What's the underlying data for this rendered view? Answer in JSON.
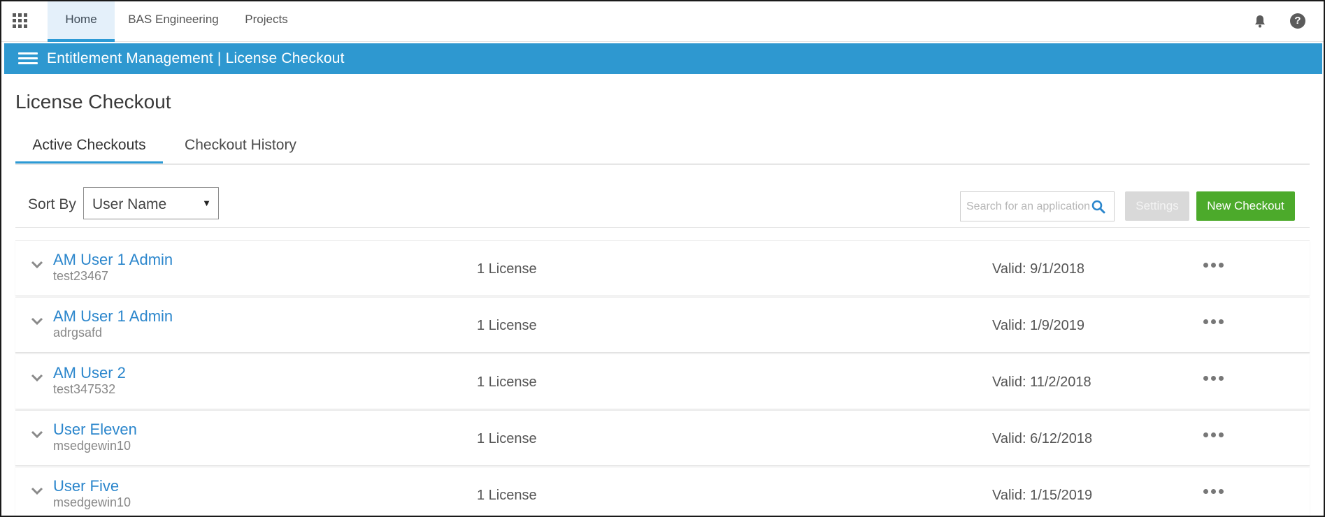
{
  "topnav": {
    "apps_icon": "apps-grid-icon",
    "tabs": [
      {
        "label": "Home",
        "active": true
      },
      {
        "label": "BAS Engineering",
        "active": false
      },
      {
        "label": "Projects",
        "active": false
      }
    ],
    "bell_icon": "bell-icon",
    "help_icon": "help-icon",
    "help_glyph": "?"
  },
  "banner": {
    "menu_icon": "hamburger-icon",
    "title": "Entitlement Management | License Checkout",
    "color": "#2e98d0"
  },
  "page": {
    "title": "License Checkout",
    "tabs": [
      {
        "label": "Active Checkouts",
        "active": true
      },
      {
        "label": "Checkout History",
        "active": false
      }
    ]
  },
  "toolbar": {
    "sort_label": "Sort By",
    "sort_value": "User Name",
    "search_placeholder": "Search for an application",
    "settings_label": "Settings",
    "new_checkout_label": "New Checkout",
    "new_checkout_color": "#4caa2b"
  },
  "checkouts": [
    {
      "name": "AM User 1 Admin",
      "machine": "test23467",
      "licenses": "1 License",
      "valid": "Valid: 9/1/2018"
    },
    {
      "name": "AM User 1 Admin",
      "machine": "adrgsafd",
      "licenses": "1 License",
      "valid": "Valid: 1/9/2019"
    },
    {
      "name": "AM User 2",
      "machine": "test347532",
      "licenses": "1 License",
      "valid": "Valid: 11/2/2018"
    },
    {
      "name": "User Eleven",
      "machine": "msedgewin10",
      "licenses": "1 License",
      "valid": "Valid: 6/12/2018"
    },
    {
      "name": "User Five",
      "machine": "msedgewin10",
      "licenses": "1 License",
      "valid": "Valid: 1/15/2019"
    }
  ]
}
